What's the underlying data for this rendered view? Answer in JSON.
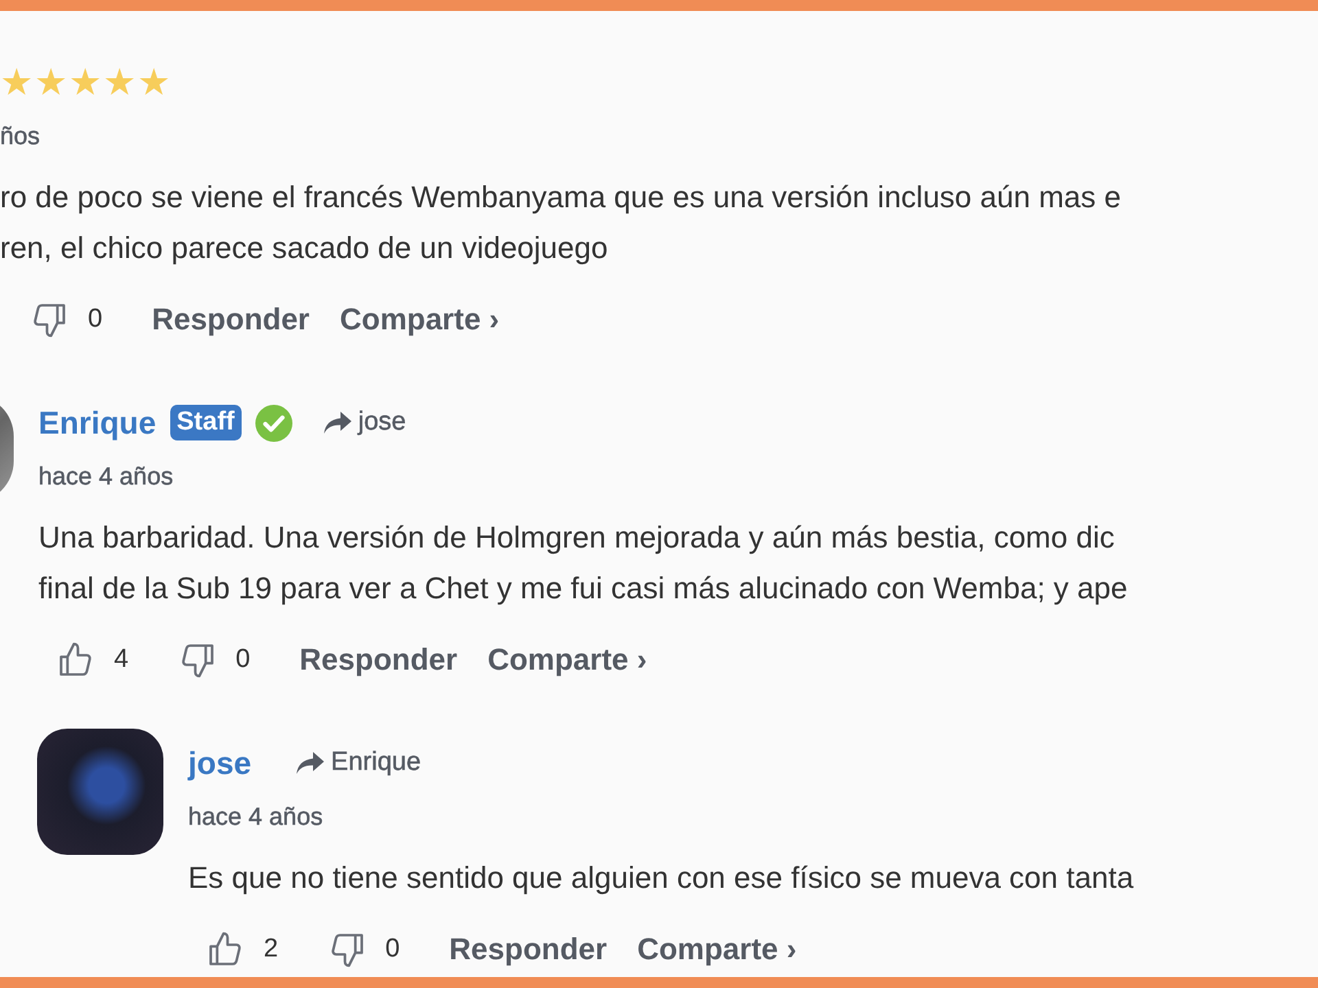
{
  "comments": [
    {
      "stars": 5,
      "time": "ños",
      "text_lines": [
        "ro de poco se viene el francés Wembanyama que es una versión incluso aún mas e",
        "ren, el chico parece sacado de un videojuego"
      ],
      "dislikes": "0",
      "reply": "Responder",
      "share": "Comparte ›",
      "children": [
        {
          "author": "Enrique",
          "badge": "Staff",
          "verified": true,
          "reply_to": "jose",
          "time": "hace 4 años",
          "text_lines": [
            "Una barbaridad. Una versión de Holmgren mejorada y aún más bestia, como dic",
            "final de la Sub 19 para ver a Chet y me fui casi más alucinado con Wemba; y ape"
          ],
          "likes": "4",
          "dislikes": "0",
          "reply": "Responder",
          "share": "Comparte ›",
          "children": [
            {
              "author": "jose",
              "verified": false,
              "reply_to": "Enrique",
              "time": "hace 4 años",
              "text_lines": [
                "Es que no tiene sentido que alguien con ese físico se mueva con tanta"
              ],
              "likes": "2",
              "dislikes": "0",
              "reply": "Responder",
              "share": "Comparte ›"
            }
          ]
        }
      ]
    }
  ]
}
